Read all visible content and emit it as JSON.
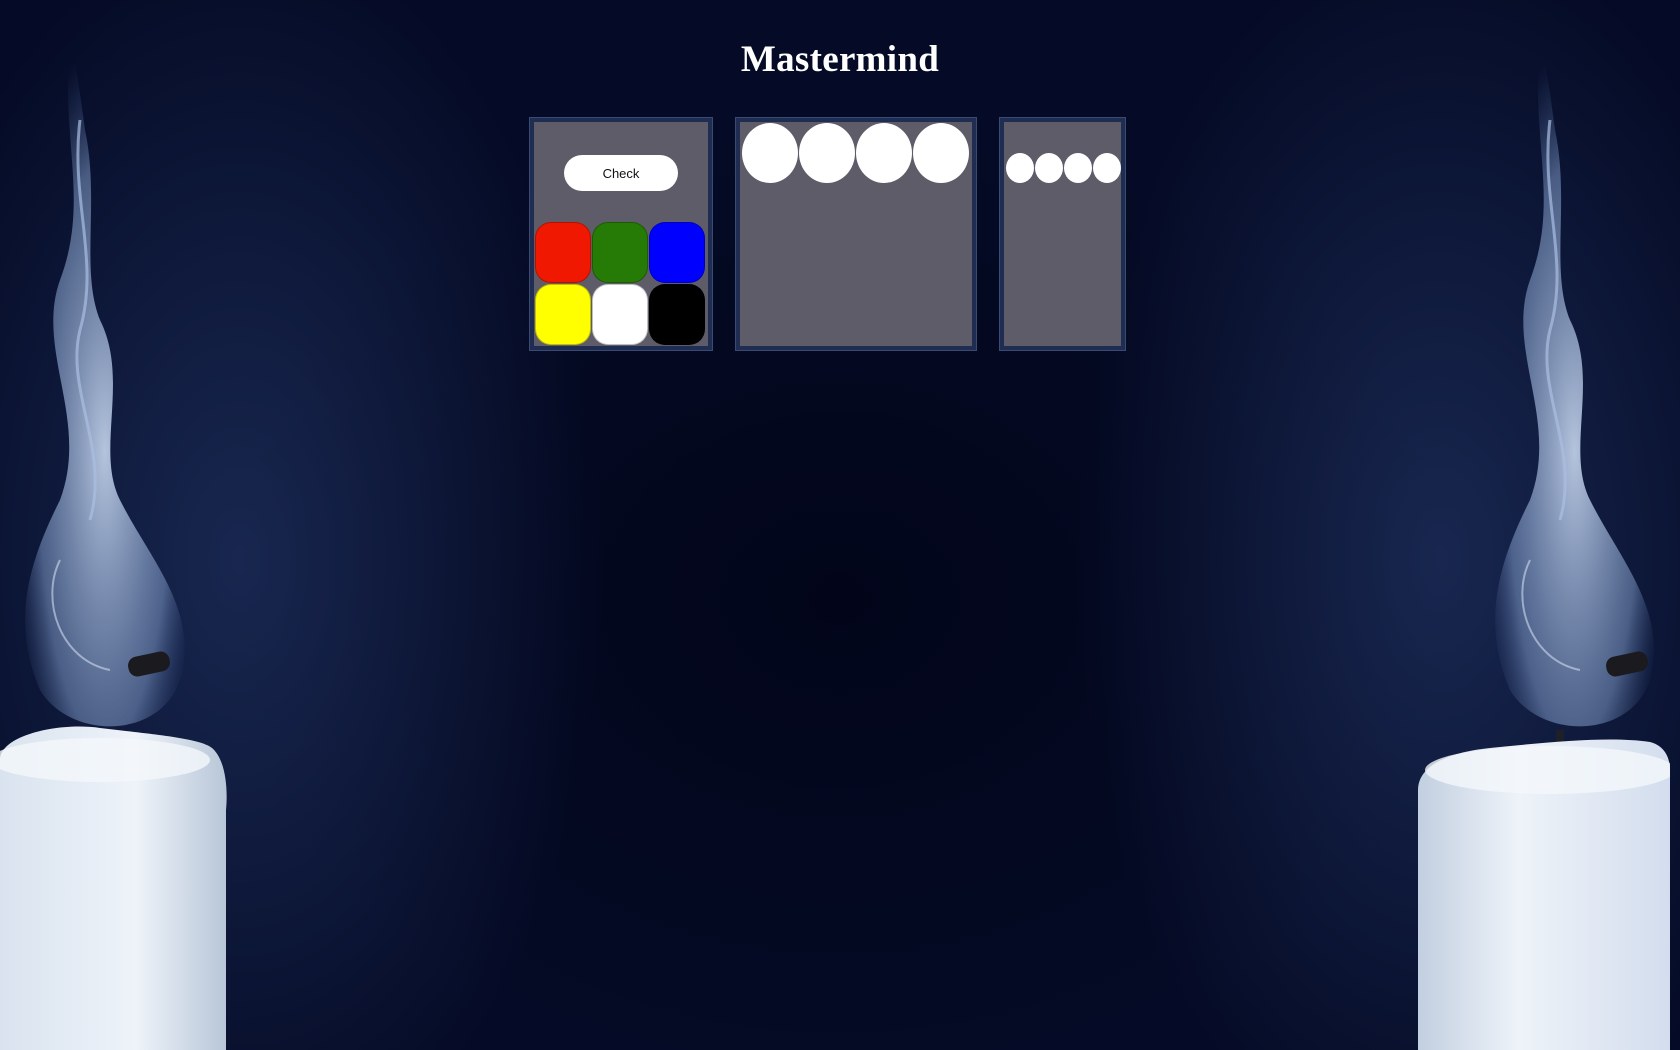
{
  "title": "Mastermind",
  "controls": {
    "check_label": "Check",
    "palette": [
      {
        "name": "red",
        "color": "#f01800"
      },
      {
        "name": "green",
        "color": "#267a06"
      },
      {
        "name": "blue",
        "color": "#0000ff"
      },
      {
        "name": "yellow",
        "color": "#ffff00"
      },
      {
        "name": "white",
        "color": "#ffffff"
      },
      {
        "name": "black",
        "color": "#000000"
      }
    ]
  },
  "guess": {
    "pegs": [
      {
        "color": "#ffffff"
      },
      {
        "color": "#ffffff"
      },
      {
        "color": "#ffffff"
      },
      {
        "color": "#ffffff"
      }
    ]
  },
  "feedback": {
    "pegs": [
      {
        "color": "#ffffff"
      },
      {
        "color": "#ffffff"
      },
      {
        "color": "#ffffff"
      },
      {
        "color": "#ffffff"
      }
    ]
  },
  "background": {
    "decoration": "candle-icon"
  }
}
